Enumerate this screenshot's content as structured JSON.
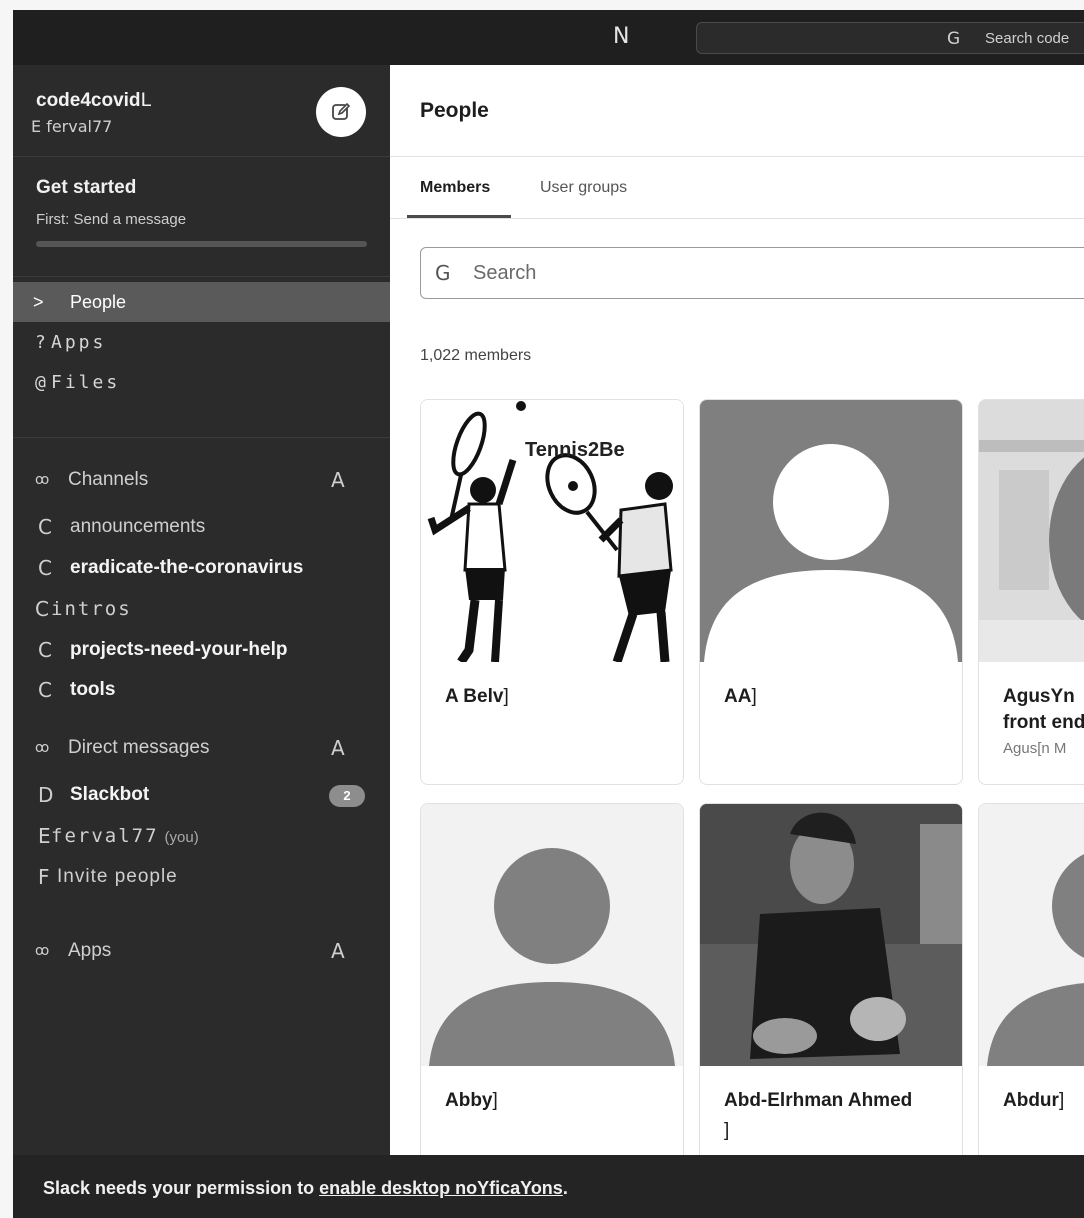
{
  "topbar": {
    "nav_icon": "N",
    "search_icon": "G",
    "search_placeholder": "Search code"
  },
  "workspace": {
    "name": "code4covid",
    "name_glyph": "L",
    "user_glyph": "E",
    "user": "ferval77",
    "compose_icon": "edit-icon"
  },
  "get_started": {
    "title": "Get started",
    "subtitle": "First: Send a message",
    "progress": 0.0
  },
  "nav": {
    "people": {
      "glyph": ">",
      "label": "People"
    },
    "apps": {
      "glyph": "?",
      "label": "Apps"
    },
    "files": {
      "glyph": "@",
      "label": "Files"
    }
  },
  "channels": {
    "header": "Channels",
    "caret": "ꝏ",
    "add": "A",
    "items": [
      {
        "glyph": "C",
        "label": "announcements",
        "unread": false
      },
      {
        "glyph": "C",
        "label": "eradicate-the-coronavirus",
        "unread": true
      },
      {
        "glyph": "C",
        "label": "intros",
        "unread": false
      },
      {
        "glyph": "C",
        "label": "projects-need-your-help",
        "unread": true
      },
      {
        "glyph": "C",
        "label": "tools",
        "unread": true
      }
    ]
  },
  "direct_messages": {
    "header": "Direct messages",
    "caret": "ꝏ",
    "add": "A",
    "items": [
      {
        "glyph": "D",
        "label": "Slackbot",
        "badge": "2"
      },
      {
        "glyph": "E",
        "label": "ferval77",
        "you": "(you)"
      },
      {
        "glyph": "F",
        "label": "Invite people"
      }
    ]
  },
  "apps_section": {
    "header": "Apps",
    "caret": "ꝏ",
    "add": "A"
  },
  "main": {
    "title": "People",
    "tabs": [
      "Members",
      "User groups"
    ],
    "search_icon": "G",
    "search_placeholder": "Search",
    "member_count": "1,022 members",
    "members": [
      {
        "name": "A Belv",
        "suffix": "]",
        "photo": "tennis-illustration",
        "photo_text": "Tennis2Be"
      },
      {
        "name": "AA",
        "suffix": "]",
        "photo": "default-avatar"
      },
      {
        "name": "AgusYn",
        "title": "front end",
        "subtitle": "Agus[n M",
        "photo": "office-portrait"
      },
      {
        "name": "Abby",
        "suffix": "]",
        "photo": "default-avatar-light"
      },
      {
        "name": "Abd-Elrhman Ahmed",
        "suffix": "]",
        "photo": "man-portrait"
      },
      {
        "name": "Abdur",
        "suffix": "]",
        "photo": "default-avatar"
      }
    ]
  },
  "banner": {
    "text": "Slack needs your permission to ",
    "link": "enable desktop noYficaYons",
    "end": "."
  }
}
